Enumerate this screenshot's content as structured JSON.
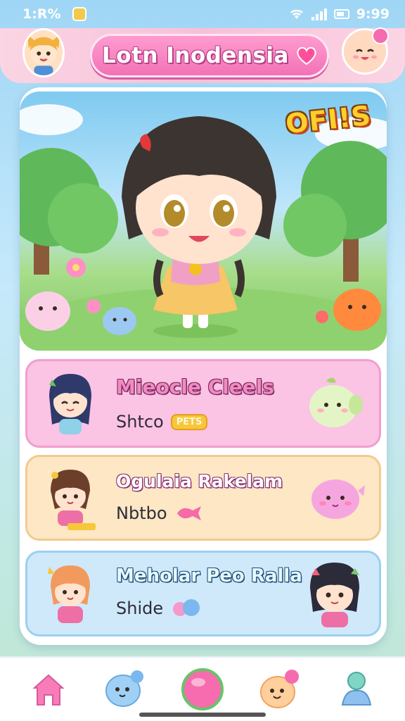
{
  "status_bar": {
    "left_text": "1:R%",
    "time": "9:99"
  },
  "header": {
    "title": "Lotn Inodensia"
  },
  "hero": {
    "badge": "OFI!S"
  },
  "quests": [
    {
      "title": "Mieocle Cleels",
      "subtitle": "Shtco",
      "tag": "PETS"
    },
    {
      "title": "Ogulaia Rakelam",
      "subtitle": "Nbtbo"
    },
    {
      "title": "Meholar Peo Ralla",
      "subtitle": "Shide"
    }
  ],
  "nav": {
    "items": [
      "home-icon",
      "chat-icon",
      "play-icon",
      "friends-icon",
      "profile-icon"
    ]
  },
  "colors": {
    "title_pill": "#f272b7",
    "card_pink": "#fbc3e4",
    "card_yellow": "#fde7c4",
    "card_blue": "#cfe9fb"
  }
}
